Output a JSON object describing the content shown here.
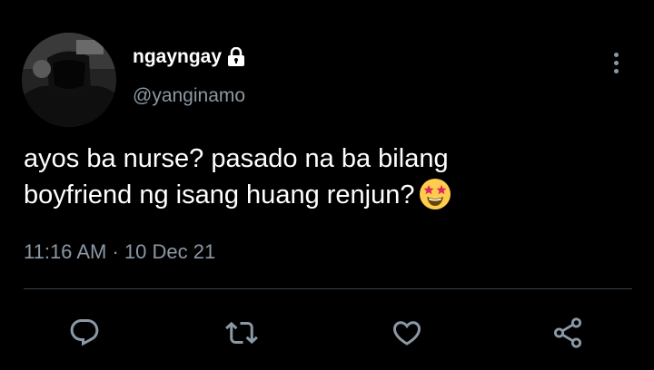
{
  "tweet": {
    "display_name": "ngayngay",
    "handle": "@yanginamo",
    "text_line1": "ayos ba nurse? pasado na ba bilang",
    "text_line2": "boyfriend ng isang huang renjun?",
    "emoji": "star-struck-emoji",
    "time": "11:16 AM",
    "separator": "·",
    "date": "10 Dec 21"
  },
  "icons": {
    "protected": "lock-icon",
    "more": "more-vertical-icon",
    "reply": "reply-icon",
    "retweet": "retweet-icon",
    "like": "heart-icon",
    "share": "share-icon"
  },
  "colors": {
    "background": "#000000",
    "text": "#ffffff",
    "secondary_text": "#8b98a5",
    "divider": "#38444d"
  }
}
